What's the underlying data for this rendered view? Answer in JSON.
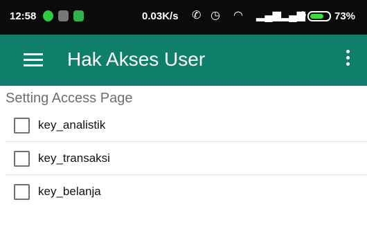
{
  "status_bar": {
    "time": "12:58",
    "net_speed": "0.03K/s",
    "battery_percent": "73%",
    "battery_level": 0.73,
    "icons": [
      "whatsapp-icon",
      "gallery-icon",
      "android-icon",
      "vibrate-icon",
      "alarm-icon",
      "wifi-icon",
      "signal-icon",
      "signal-icon",
      "charging-icon",
      "battery-icon"
    ]
  },
  "app_bar": {
    "title": "Hak Akses User",
    "background": "#0f7e6b"
  },
  "content": {
    "section_title": "Setting Access Page",
    "items": [
      {
        "label": "key_analistik",
        "checked": false
      },
      {
        "label": "key_transaksi",
        "checked": false
      },
      {
        "label": "key_belanja",
        "checked": false
      }
    ]
  }
}
